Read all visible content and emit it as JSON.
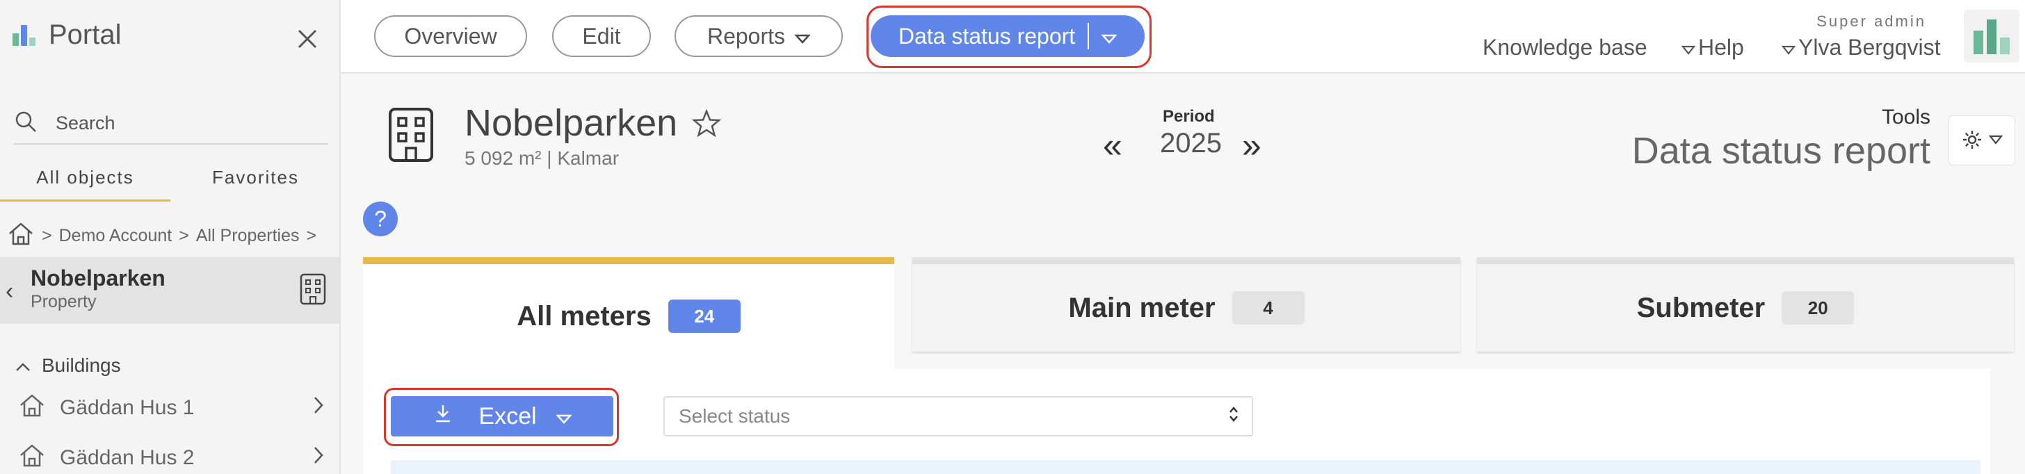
{
  "sidebar": {
    "brand": "Portal",
    "search_placeholder": "Search",
    "tabs": [
      "All objects",
      "Favorites"
    ],
    "breadcrumb": [
      "Demo Account",
      "All Properties"
    ],
    "current": {
      "name": "Nobelparken",
      "type": "Property"
    },
    "section": "Buildings",
    "buildings": [
      "Gäddan Hus 1",
      "Gäddan Hus 2"
    ]
  },
  "topnav": {
    "overview": "Overview",
    "edit": "Edit",
    "reports": "Reports",
    "data_status_report": "Data status report",
    "knowledge_base": "Knowledge base",
    "help": "Help",
    "user_role": "Super admin",
    "user_name": "Ylva Bergqvist"
  },
  "header": {
    "title": "Nobelparken",
    "subtitle": "5 092 m² | Kalmar",
    "period_label": "Period",
    "year": "2025",
    "tools_label": "Tools",
    "report_title": "Data status report",
    "help_glyph": "?"
  },
  "meter_tabs": [
    {
      "label": "All meters",
      "count": "24"
    },
    {
      "label": "Main meter",
      "count": "4"
    },
    {
      "label": "Submeter",
      "count": "20"
    }
  ],
  "controls": {
    "excel_label": "Excel",
    "status_placeholder": "Select status"
  },
  "colors": {
    "accent": "#5f86e8",
    "active_tab": "#e7b94a",
    "highlight_ring": "#d4372c"
  },
  "icons": [
    "brand-logo-icon",
    "close-icon",
    "search-icon",
    "home-icon",
    "building-icon",
    "star-icon",
    "gear-icon",
    "download-icon",
    "chevron-down-icon"
  ]
}
